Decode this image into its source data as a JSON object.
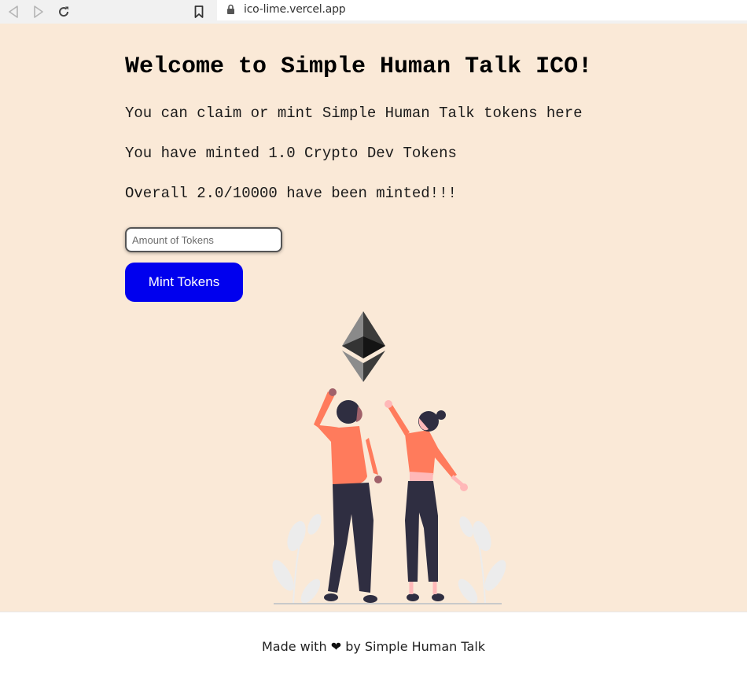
{
  "browser": {
    "url": "ico-lime.vercel.app"
  },
  "page": {
    "title": "Welcome to Simple Human Talk ICO!",
    "description": "You can claim or mint Simple Human Talk tokens here",
    "minted_text": "You have minted 1.0 Crypto Dev Tokens",
    "overall_text": "Overall 2.0/10000 have been minted!!!",
    "amount_input": {
      "placeholder": "Amount of Tokens",
      "value": ""
    },
    "mint_button_label": "Mint Tokens"
  },
  "footer": {
    "made_with": "Made with",
    "heart_icon": "heart-icon",
    "by_text": "by Simple Human Talk"
  },
  "colors": {
    "background": "#fae9d7",
    "button": "#0000ee",
    "accent_person": "#ff7b5c"
  }
}
